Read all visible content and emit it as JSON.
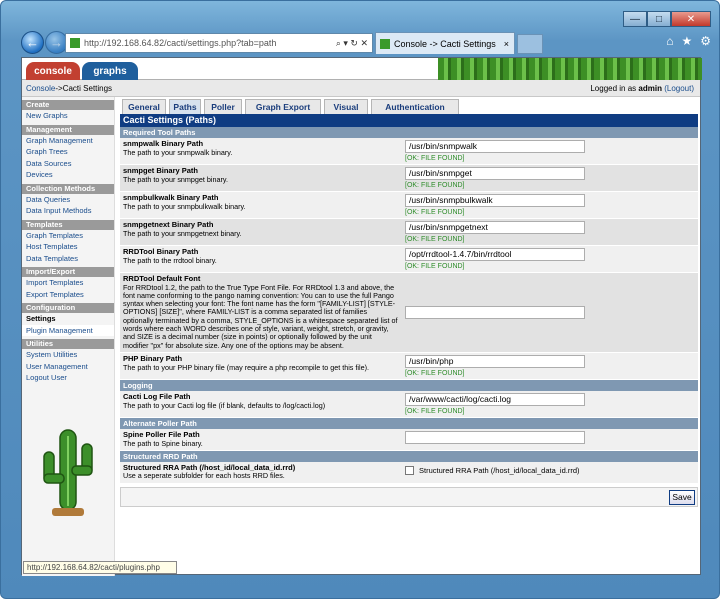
{
  "browser": {
    "address": "http://192.168.64.82/cacti/settings.php?tab=path",
    "tab_title": "Console -> Cacti Settings",
    "status": "http://192.168.64.82/cacti/plugins.php"
  },
  "app": {
    "tabs": [
      "console",
      "graphs"
    ],
    "breadcrumb_link": "Console",
    "breadcrumb_sep": " -> ",
    "breadcrumb_current": "Cacti Settings",
    "logged_in": "Logged in as ",
    "user": "admin",
    "logout": "(Logout)"
  },
  "sidebar": [
    {
      "head": "Create",
      "items": [
        "New Graphs"
      ]
    },
    {
      "head": "Management",
      "items": [
        "Graph Management",
        "Graph Trees",
        "Data Sources",
        "Devices"
      ]
    },
    {
      "head": "Collection Methods",
      "items": [
        "Data Queries",
        "Data Input Methods"
      ]
    },
    {
      "head": "Templates",
      "items": [
        "Graph Templates",
        "Host Templates",
        "Data Templates"
      ]
    },
    {
      "head": "Import/Export",
      "items": [
        "Import Templates",
        "Export Templates"
      ]
    },
    {
      "head": "Configuration",
      "items": [
        "Settings",
        "Plugin Management"
      ]
    },
    {
      "head": "Utilities",
      "items": [
        "System Utilities",
        "User Management",
        "Logout User"
      ]
    }
  ],
  "settings": {
    "tabs": [
      "General",
      "Paths",
      "Poller",
      "Graph Export",
      "Visual",
      "Authentication"
    ],
    "title": "Cacti Settings (Paths)",
    "sec_required": "Required Tool Paths",
    "snmpwalk": {
      "t": "snmpwalk Binary Path",
      "d": "The path to your snmpwalk binary.",
      "v": "/usr/bin/snmpwalk",
      "s": "[OK: FILE FOUND]"
    },
    "snmpget": {
      "t": "snmpget Binary Path",
      "d": "The path to your snmpget binary.",
      "v": "/usr/bin/snmpget",
      "s": "[OK: FILE FOUND]"
    },
    "snmpbulkwalk": {
      "t": "snmpbulkwalk Binary Path",
      "d": "The path to your snmpbulkwalk binary.",
      "v": "/usr/bin/snmpbulkwalk",
      "s": "[OK: FILE FOUND]"
    },
    "snmpgetnext": {
      "t": "snmpgetnext Binary Path",
      "d": "The path to your snmpgetnext binary.",
      "v": "/usr/bin/snmpgetnext",
      "s": "[OK: FILE FOUND]"
    },
    "rrdtool": {
      "t": "RRDTool Binary Path",
      "d": "The path to the rrdtool binary.",
      "v": "/opt/rrdtool-1.4.7/bin/rrdtool",
      "s": "[OK: FILE FOUND]"
    },
    "font": {
      "t": "RRDTool Default Font",
      "d": "For RRDtool 1.2, the path to the True Type Font File. For RRDtool 1.3 and above, the font name conforming to the pango naming convention: You can to use the full Pango syntax when selecting your font: The font name has the form \"[FAMILY-LIST] [STYLE-OPTIONS] [SIZE]\", where FAMILY-LIST is a comma separated list of families optionally terminated by a comma, STYLE_OPTIONS is a whitespace separated list of words where each WORD describes one of style, variant, weight, stretch, or gravity, and SIZE is a decimal number (size in points) or optionally followed by the unit modifier \"px\" for absolute size. Any one of the options may be absent.",
      "v": ""
    },
    "php": {
      "t": "PHP Binary Path",
      "d": "The path to your PHP binary file (may require a php recompile to get this file).",
      "v": "/usr/bin/php",
      "s": "[OK: FILE FOUND]"
    },
    "sec_logging": "Logging",
    "log": {
      "t": "Cacti Log File Path",
      "d": "The path to your Cacti log file (if blank, defaults to /log/cacti.log)",
      "v": "/var/www/cacti/log/cacti.log",
      "s": "[OK: FILE FOUND]"
    },
    "sec_alt": "Alternate Poller Path",
    "spine": {
      "t": "Spine Poller File Path",
      "d": "The path to Spine binary.",
      "v": ""
    },
    "sec_rrd": "Structured RRD Path",
    "rra": {
      "t": "Structured RRA Path (/host_id/local_data_id.rrd)",
      "d": "Use a seperate subfolder for each hosts RRD files.",
      "c": "Structured RRA Path (/host_id/local_data_id.rrd)"
    },
    "save": "Save"
  }
}
